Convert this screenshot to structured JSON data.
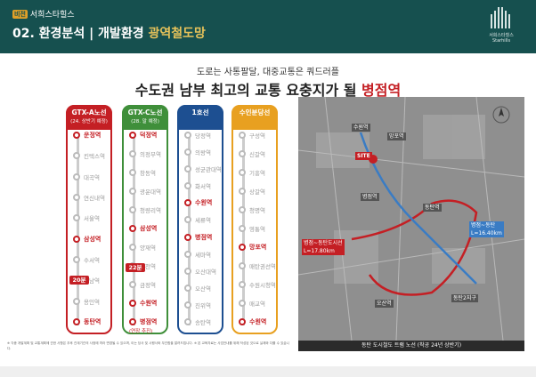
{
  "header": {
    "brand_badge": "비전",
    "brand": "서희스타힐스",
    "title_main": "02. 환경분석 | 개발환경",
    "title_accent": "광역철도망",
    "logo_text": "서희스타힐스",
    "logo_sub": "Starhills"
  },
  "subtitle": "도로는 사통팔달, 대중교통은 쿼드러플",
  "headline": {
    "pre": "수도권 남부 최고의 교통 요충지가 될 ",
    "accent": "병점역"
  },
  "lines": [
    {
      "name": "GTX-A노선",
      "sub": "(24. 상반기 예정)",
      "color": "#c41f24",
      "stations": [
        {
          "name": "운정역",
          "hl": true
        },
        {
          "name": "킨텍스역",
          "hl": false
        },
        {
          "name": "대곡역",
          "hl": false
        },
        {
          "name": "연신내역",
          "hl": false
        },
        {
          "name": "서울역",
          "hl": false
        },
        {
          "name": "삼성역",
          "hl": true
        },
        {
          "name": "수서역",
          "hl": false
        },
        {
          "name": "성남역",
          "hl": false
        },
        {
          "name": "용인역",
          "hl": false
        },
        {
          "name": "동탄역",
          "hl": true
        }
      ],
      "travel": "20분"
    },
    {
      "name": "GTX-C노선",
      "sub": "(28. 말 예정)",
      "color": "#3f8f3a",
      "stations": [
        {
          "name": "덕정역",
          "hl": true
        },
        {
          "name": "의정부역",
          "hl": false
        },
        {
          "name": "창동역",
          "hl": false
        },
        {
          "name": "광운대역",
          "hl": false
        },
        {
          "name": "청량리역",
          "hl": false
        },
        {
          "name": "삼성역",
          "hl": true
        },
        {
          "name": "양재역",
          "hl": false
        },
        {
          "name": "과천역",
          "hl": false
        },
        {
          "name": "금정역",
          "hl": false
        },
        {
          "name": "수원역",
          "hl": true
        },
        {
          "name": "병점역",
          "hl": true
        }
      ],
      "travel": "22분",
      "note": "(연장 추진)"
    },
    {
      "name": "1호선",
      "sub": "",
      "color": "#1d4f91",
      "stations": [
        {
          "name": "당정역",
          "hl": false
        },
        {
          "name": "의왕역",
          "hl": false
        },
        {
          "name": "성균관대역",
          "hl": false
        },
        {
          "name": "화서역",
          "hl": false
        },
        {
          "name": "수원역",
          "hl": true
        },
        {
          "name": "세류역",
          "hl": false
        },
        {
          "name": "병점역",
          "hl": true
        },
        {
          "name": "세마역",
          "hl": false
        },
        {
          "name": "오산대역",
          "hl": false
        },
        {
          "name": "오산역",
          "hl": false
        },
        {
          "name": "진위역",
          "hl": false
        },
        {
          "name": "송탄역",
          "hl": false
        }
      ]
    },
    {
      "name": "수인분당선",
      "sub": "",
      "color": "#e8a020",
      "stations": [
        {
          "name": "구성역",
          "hl": false
        },
        {
          "name": "신갈역",
          "hl": false
        },
        {
          "name": "기흥역",
          "hl": false
        },
        {
          "name": "상갈역",
          "hl": false
        },
        {
          "name": "청명역",
          "hl": false
        },
        {
          "name": "영통역",
          "hl": false
        },
        {
          "name": "망포역",
          "hl": true
        },
        {
          "name": "매탄권선역",
          "hl": false
        },
        {
          "name": "수원시청역",
          "hl": false
        },
        {
          "name": "매교역",
          "hl": false
        },
        {
          "name": "수원역",
          "hl": true
        }
      ]
    }
  ],
  "map": {
    "site": "SITE",
    "labels": [
      "병점역",
      "오산역",
      "동탄역",
      "망포역",
      "수원역",
      "동탄2지구"
    ],
    "line_a": "병점~동탄도시선\nL=17.80km",
    "line_b": "병점~동탄\nL=16.40km",
    "caption": "동탄 도시철도 트램 노선 (착공 24년 상반기)"
  },
  "footnotes": "※ 각종 개발계획 및 교통계획에 관한 사항은 추후 관계기관의 사정에 따라 변경될 수 있으며, 이는 당사 및 시행사와 무관함을 알려드립니다. ※ 본 교육자료는 사업안내를 위해 작성된 것으로 실제와 다를 수 있습니다."
}
